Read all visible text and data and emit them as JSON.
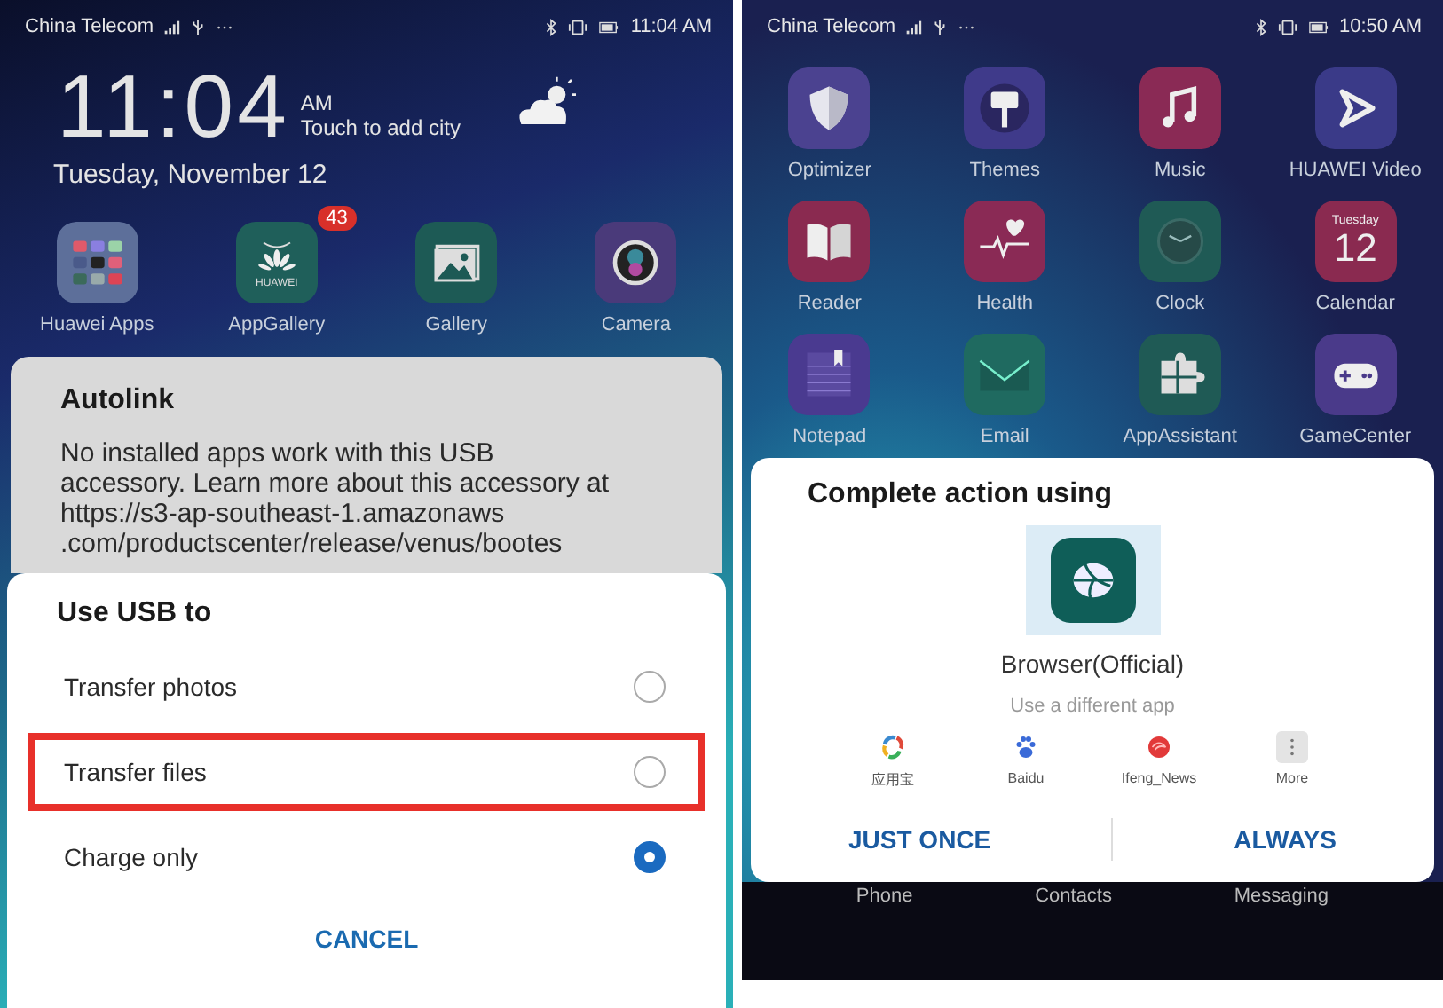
{
  "left_screen": {
    "status_bar": {
      "carrier": "China Telecom",
      "time": "11:04 AM"
    },
    "clock": {
      "time": "11:04",
      "ampm": "AM",
      "weather_hint": "Touch to add city",
      "date": "Tuesday, November 12"
    },
    "apps": [
      {
        "label": "Huawei Apps",
        "kind": "folder"
      },
      {
        "label": "AppGallery",
        "kind": "store",
        "icon_text": "HUAWEI",
        "badge": "43"
      },
      {
        "label": "Gallery",
        "kind": "gallery"
      },
      {
        "label": "Camera",
        "kind": "camera"
      }
    ],
    "autolink_dialog": {
      "title": "Autolink",
      "message": "No installed apps work with this USB accessory. Learn more about this accessory at https://s3-ap-southeast-1.amazonaws .com/productscenter/release/venus/bootes"
    },
    "usb_dialog": {
      "title": "Use USB to",
      "options": [
        {
          "label": "Transfer photos",
          "selected": false,
          "highlighted": false
        },
        {
          "label": "Transfer files",
          "selected": false,
          "highlighted": true
        },
        {
          "label": "Charge only",
          "selected": true,
          "highlighted": false
        }
      ],
      "cancel": "CANCEL"
    }
  },
  "right_screen": {
    "status_bar": {
      "carrier": "China Telecom",
      "time": "10:50 AM"
    },
    "apps": [
      {
        "label": "Optimizer",
        "kind": "shield"
      },
      {
        "label": "Themes",
        "kind": "brush"
      },
      {
        "label": "Music",
        "kind": "music"
      },
      {
        "label": "HUAWEI Video",
        "kind": "play"
      },
      {
        "label": "Reader",
        "kind": "book"
      },
      {
        "label": "Health",
        "kind": "heart"
      },
      {
        "label": "Clock",
        "kind": "clock"
      },
      {
        "label": "Calendar",
        "kind": "calendar",
        "icon_day": "Tuesday",
        "icon_date": "12"
      },
      {
        "label": "Notepad",
        "kind": "notepad"
      },
      {
        "label": "Email",
        "kind": "mail"
      },
      {
        "label": "AppAssistant",
        "kind": "puzzle"
      },
      {
        "label": "GameCenter",
        "kind": "gamepad"
      }
    ],
    "chooser_dialog": {
      "title": "Complete action using",
      "default_app": {
        "label": "Browser(Official)",
        "kind": "browser"
      },
      "hint": "Use a different app",
      "other_apps": [
        {
          "label": "应用宝",
          "kind": "swirl"
        },
        {
          "label": "Baidu",
          "kind": "paw"
        },
        {
          "label": "Ifeng_News",
          "kind": "spiral"
        },
        {
          "label": "More",
          "kind": "more"
        }
      ],
      "buttons": [
        "JUST ONCE",
        "ALWAYS"
      ]
    },
    "dock": [
      "Phone",
      "Contacts",
      "Messaging"
    ]
  }
}
